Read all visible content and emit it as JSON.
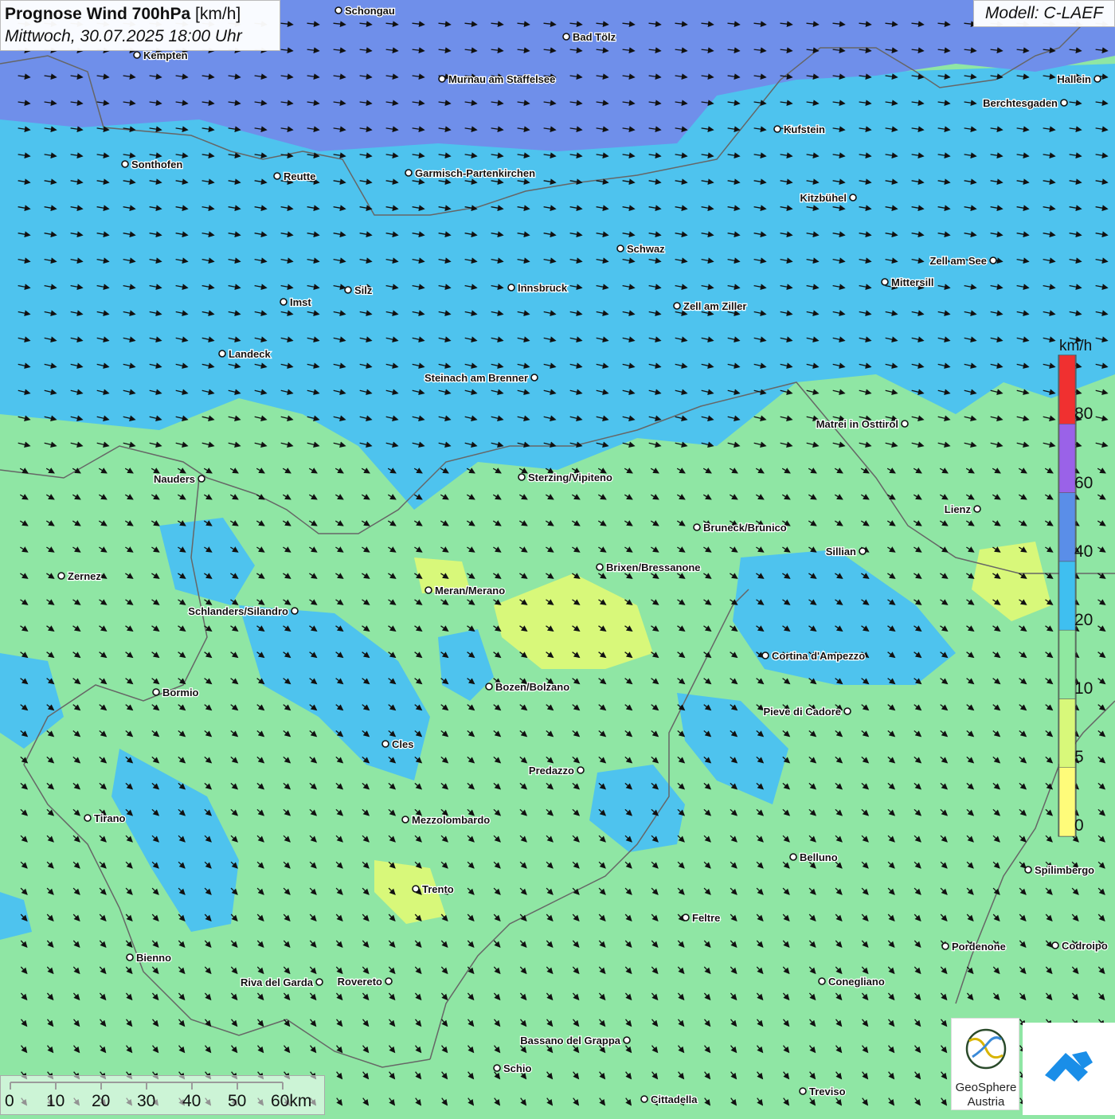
{
  "header": {
    "title_bold": "Prognose Wind 700hPa",
    "title_unit": "[km/h]",
    "subtitle": "Mittwoch, 30.07.2025 18:00 Uhr",
    "model": "Modell: C-LAEF"
  },
  "legend": {
    "unit": "km/h",
    "bins": [
      {
        "label": "0",
        "color": "#fefc7a"
      },
      {
        "label": "5",
        "color": "#d8f87a"
      },
      {
        "label": "10",
        "color": "#8fe8a0"
      },
      {
        "label": "20",
        "color": "#3fbff0"
      },
      {
        "label": "40",
        "color": "#5a8ee8"
      },
      {
        "label": "60",
        "color": "#9a62e8"
      },
      {
        "label": "80",
        "color": "#f03030"
      }
    ]
  },
  "scale_bar": {
    "ticks": [
      "0",
      "10",
      "20",
      "30",
      "40",
      "50",
      "60km"
    ]
  },
  "branding": {
    "geosphere_line1": "GeoSphere",
    "geosphere_line2": "Austria"
  },
  "cities": [
    {
      "name": "Schongau",
      "label": "Schongau"
    },
    {
      "name": "Bad Tölz",
      "label": "Bad Tölz"
    },
    {
      "name": "Kempten",
      "label": "Kempten"
    },
    {
      "name": "Murnau",
      "label": "Murnau am Staffelsee"
    },
    {
      "name": "Hallein",
      "label": "Hallein"
    },
    {
      "name": "Berchtesgaden",
      "label": "Berchtesgaden"
    },
    {
      "name": "Kufstein",
      "label": "Kufstein"
    },
    {
      "name": "Sonthofen",
      "label": "Sonthofen"
    },
    {
      "name": "Reutte",
      "label": "Reutte"
    },
    {
      "name": "Garmisch",
      "label": "Garmisch-Partenkirchen"
    },
    {
      "name": "Kitzbühel",
      "label": "Kitzbühel"
    },
    {
      "name": "Schwaz",
      "label": "Schwaz"
    },
    {
      "name": "Zell am See",
      "label": "Zell am See"
    },
    {
      "name": "Mittersill",
      "label": "Mittersill"
    },
    {
      "name": "Silz",
      "label": "Silz"
    },
    {
      "name": "Innsbruck",
      "label": "Innsbruck"
    },
    {
      "name": "Imst",
      "label": "Imst"
    },
    {
      "name": "Zell am Ziller",
      "label": "Zell am Ziller"
    },
    {
      "name": "Landeck",
      "label": "Landeck"
    },
    {
      "name": "Steinach",
      "label": "Steinach am Brenner"
    },
    {
      "name": "Matrei",
      "label": "Matrei in Osttirol"
    },
    {
      "name": "Nauders",
      "label": "Nauders"
    },
    {
      "name": "Sterzing",
      "label": "Sterzing/Vipiteno"
    },
    {
      "name": "Lienz",
      "label": "Lienz"
    },
    {
      "name": "Bruneck",
      "label": "Bruneck/Brunico"
    },
    {
      "name": "Sillian",
      "label": "Sillian"
    },
    {
      "name": "Brixen",
      "label": "Brixen/Bressanone"
    },
    {
      "name": "Zernez",
      "label": "Zernez"
    },
    {
      "name": "Meran",
      "label": "Meran/Merano"
    },
    {
      "name": "Schlanders",
      "label": "Schlanders/Silandro"
    },
    {
      "name": "Cortina",
      "label": "Cortina d'Ampezzo"
    },
    {
      "name": "Bozen",
      "label": "Bozen/Bolzano"
    },
    {
      "name": "Bormio",
      "label": "Bormio"
    },
    {
      "name": "Pieve",
      "label": "Pieve di Cadore"
    },
    {
      "name": "Cles",
      "label": "Cles"
    },
    {
      "name": "Predazzo",
      "label": "Predazzo"
    },
    {
      "name": "Tirano",
      "label": "Tirano"
    },
    {
      "name": "Mezzolombardo",
      "label": "Mezzolombardo"
    },
    {
      "name": "Belluno",
      "label": "Belluno"
    },
    {
      "name": "Spilimbergo",
      "label": "Spilimbergo"
    },
    {
      "name": "Trento",
      "label": "Trento"
    },
    {
      "name": "Feltre",
      "label": "Feltre"
    },
    {
      "name": "Pordenone",
      "label": "Pordenone"
    },
    {
      "name": "Codroipo",
      "label": "Codroipo"
    },
    {
      "name": "Bienno",
      "label": "Bienno"
    },
    {
      "name": "Riva",
      "label": "Riva del Garda"
    },
    {
      "name": "Rovereto",
      "label": "Rovereto"
    },
    {
      "name": "Conegliano",
      "label": "Conegliano"
    },
    {
      "name": "Bassano",
      "label": "Bassano del Grappa"
    },
    {
      "name": "Schio",
      "label": "Schio"
    },
    {
      "name": "Treviso",
      "label": "Treviso"
    },
    {
      "name": "Cittadella",
      "label": "Cittadella"
    }
  ]
}
